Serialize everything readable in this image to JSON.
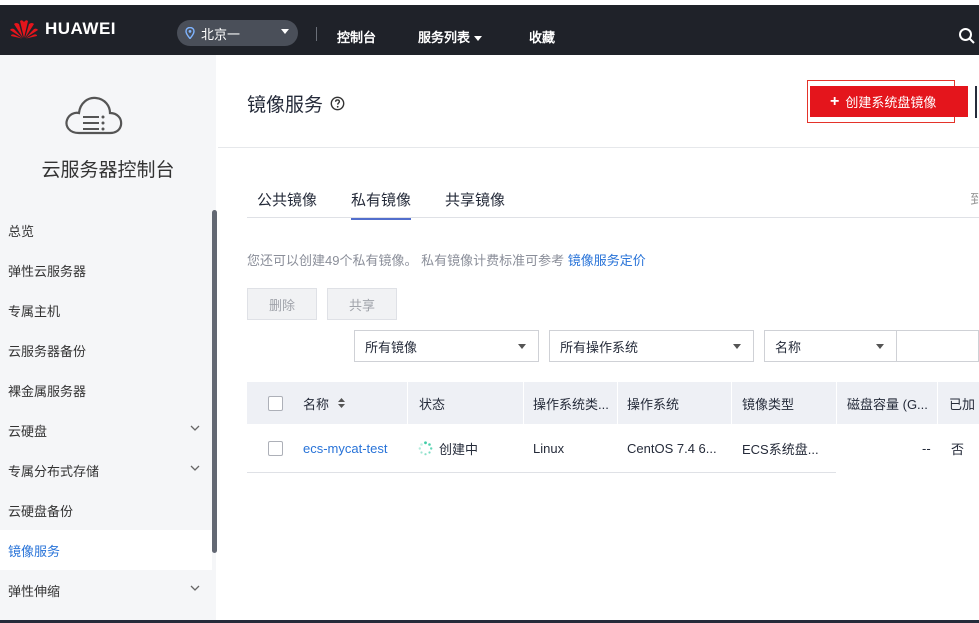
{
  "topbar": {
    "brand": "HUAWEI",
    "region": "北京一",
    "nav": [
      "控制台",
      "服务列表",
      "收藏"
    ]
  },
  "sidebar": {
    "title": "云服务器控制台",
    "items": [
      {
        "label": "总览",
        "expandable": false,
        "active": false
      },
      {
        "label": "弹性云服务器",
        "expandable": false,
        "active": false
      },
      {
        "label": "专属主机",
        "expandable": false,
        "active": false
      },
      {
        "label": "云服务器备份",
        "expandable": false,
        "active": false
      },
      {
        "label": "裸金属服务器",
        "expandable": false,
        "active": false
      },
      {
        "label": "云硬盘",
        "expandable": true,
        "active": false
      },
      {
        "label": "专属分布式存储",
        "expandable": true,
        "active": false
      },
      {
        "label": "云硬盘备份",
        "expandable": false,
        "active": false
      },
      {
        "label": "镜像服务",
        "expandable": false,
        "active": true
      },
      {
        "label": "弹性伸缩",
        "expandable": true,
        "active": false
      }
    ]
  },
  "main": {
    "title": "镜像服务",
    "create_button": "创建系统盘镜像",
    "tabs": [
      {
        "label": "公共镜像",
        "active": false
      },
      {
        "label": "私有镜像",
        "active": true
      },
      {
        "label": "共享镜像",
        "active": false
      }
    ],
    "tab_right_text": "到",
    "notice_text": "您还可以创建49个私有镜像。 私有镜像计费标准可参考 ",
    "notice_link": "镜像服务定价",
    "actions": {
      "delete": "删除",
      "share": "共享"
    },
    "filters": {
      "image_scope": "所有镜像",
      "os": "所有操作系统",
      "field": "名称"
    },
    "table": {
      "columns": [
        "名称",
        "状态",
        "操作系统类...",
        "操作系统",
        "镜像类型",
        "磁盘容量 (G...",
        "已加"
      ],
      "rows": [
        {
          "name": "ecs-mycat-test",
          "status": "创建中",
          "os_type": "Linux",
          "os": "CentOS 7.4 6...",
          "image_type": "ECS系统盘...",
          "disk": "--",
          "encrypted": "否"
        }
      ]
    }
  },
  "colors": {
    "topbar_bg": "#1f2229",
    "accent_red": "#e4151c",
    "link_blue": "#2873d8",
    "tab_active": "#526ecc",
    "spinner_green": "#3dcca6"
  }
}
